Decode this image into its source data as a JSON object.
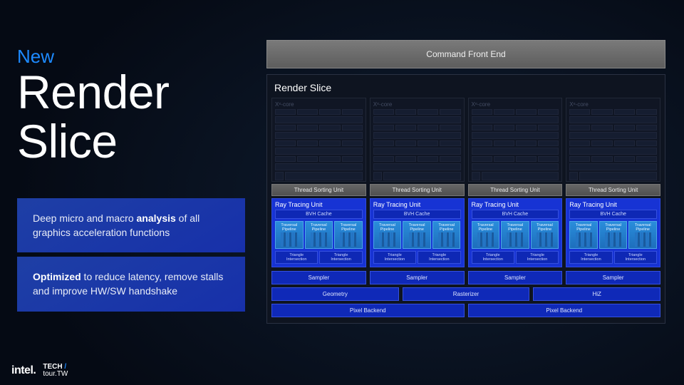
{
  "header": {
    "new_label": "New",
    "title_line1": "Render",
    "title_line2": "Slice"
  },
  "info_boxes": {
    "box1_pre": "Deep micro and macro ",
    "box1_bold": "analysis",
    "box1_post": " of all graphics acceleration functions",
    "box2_bold": "Optimized",
    "box2_post": " to reduce latency, remove stalls and improve HW/SW handshake"
  },
  "diagram": {
    "command_front_end": "Command Front End",
    "render_slice_title": "Render Slice",
    "xe_core_label": "Xᵉ-core",
    "thread_sorting_unit": "Thread Sorting Unit",
    "ray_tracing_unit": "Ray Tracing Unit",
    "bvh_cache": "BVH Cache",
    "traversal_line1": "Traversal",
    "traversal_line2": "Pipeline",
    "triangle_line1": "Triangle",
    "triangle_line2": "Intersection",
    "sampler": "Sampler",
    "geometry": "Geometry",
    "rasterizer": "Rasterizer",
    "hiz": "HiZ",
    "pixel_backend": "Pixel Backend",
    "core_count": 4,
    "traversal_per_core": 3,
    "triangle_per_core": 2,
    "samplers": 4
  },
  "footer": {
    "intel": "intel.",
    "tech": "TECH",
    "tour": "tour",
    "tw": "TW"
  }
}
